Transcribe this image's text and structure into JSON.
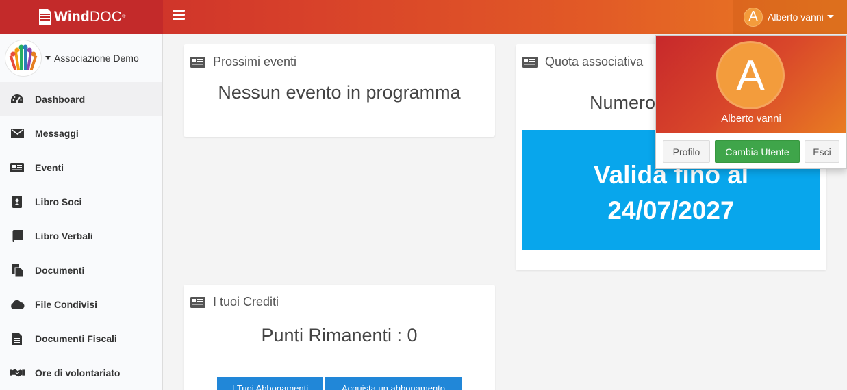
{
  "header": {
    "logo_bold": "Wind",
    "logo_light": "DOC",
    "logo_reg": "®",
    "user_initial": "A",
    "user_name": "Alberto vanni"
  },
  "sidebar": {
    "org_name": "Associazione Demo",
    "items": [
      {
        "label": "Dashboard",
        "icon": "dashboard-gauge-icon"
      },
      {
        "label": "Messaggi",
        "icon": "envelope-icon"
      },
      {
        "label": "Eventi",
        "icon": "newspaper-icon"
      },
      {
        "label": "Libro Soci",
        "icon": "address-book-icon"
      },
      {
        "label": "Libro Verbali",
        "icon": "book-icon"
      },
      {
        "label": "Documenti",
        "icon": "files-icon"
      },
      {
        "label": "File Condivisi",
        "icon": "cloud-icon"
      },
      {
        "label": "Documenti Fiscali",
        "icon": "file-text-icon"
      },
      {
        "label": "Ore di volontariato",
        "icon": "handshake-icon"
      }
    ]
  },
  "cards": {
    "events": {
      "title": "Prossimi eventi",
      "message": "Nessun evento in programma"
    },
    "quota": {
      "title": "Quota associativa",
      "number_label": "Numero",
      "valid_line1": "Valida fino al",
      "valid_line2": "24/07/2027"
    },
    "credits": {
      "title": "I tuoi Crediti",
      "points": "Punti Rimanenti : 0",
      "btn_subscriptions": "I Tuoi Abbonamenti",
      "btn_buy": "Acquista un abbonamento"
    }
  },
  "dropdown": {
    "initial": "A",
    "name": "Alberto vanni",
    "btn_profile": "Profilo",
    "btn_switch": "Cambia Utente",
    "btn_logout": "Esci"
  },
  "colors": {
    "header_start": "#c7282b",
    "header_end": "#e97d22",
    "accent_blue": "#08a6ec",
    "button_blue": "#2187d8",
    "button_green": "#3fa54a"
  }
}
